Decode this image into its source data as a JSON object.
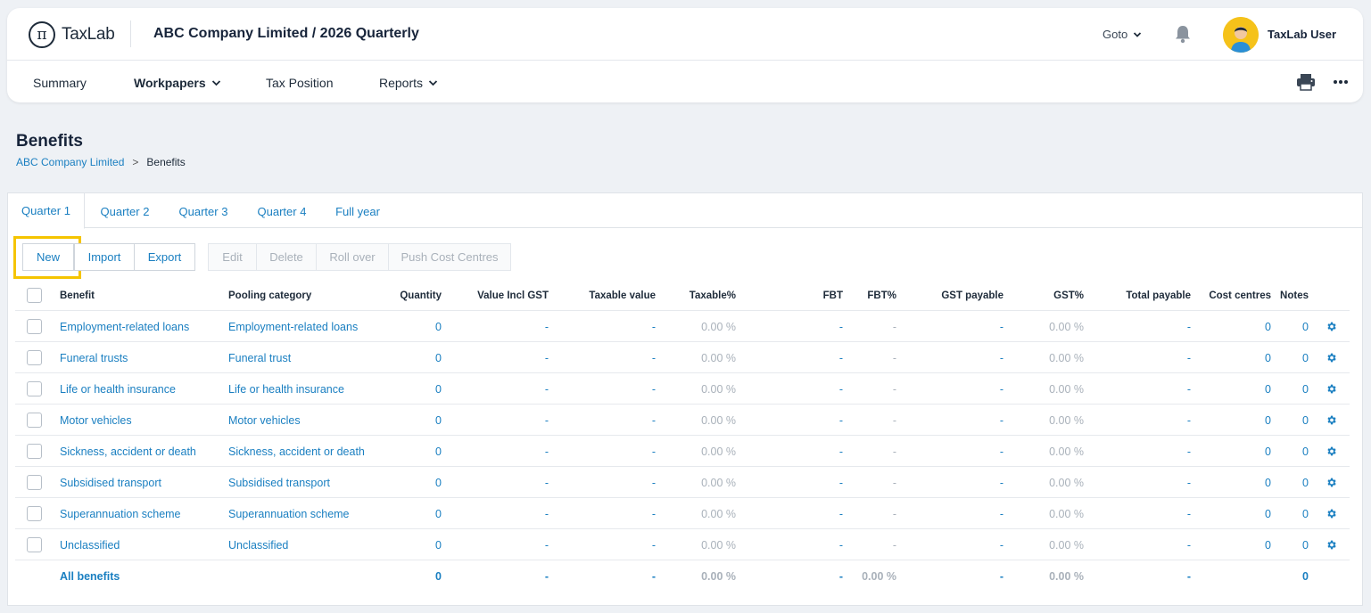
{
  "app": {
    "logo_text": "TaxLab",
    "company_title": "ABC Company Limited / 2026 Quarterly",
    "goto_label": "Goto",
    "user_name": "TaxLab User"
  },
  "nav": {
    "summary": "Summary",
    "workpapers": "Workpapers",
    "tax_position": "Tax Position",
    "reports": "Reports"
  },
  "page": {
    "title": "Benefits",
    "breadcrumb_parent": "ABC Company Limited",
    "breadcrumb_separator": ">",
    "breadcrumb_current": "Benefits"
  },
  "tabs": [
    "Quarter 1",
    "Quarter 2",
    "Quarter 3",
    "Quarter 4",
    "Full year"
  ],
  "toolbar": {
    "new": "New",
    "import": "Import",
    "export": "Export",
    "edit": "Edit",
    "delete": "Delete",
    "roll_over": "Roll over",
    "push_cost_centres": "Push Cost Centres"
  },
  "table": {
    "headers": {
      "benefit": "Benefit",
      "pooling": "Pooling category",
      "quantity": "Quantity",
      "value_incl_gst": "Value Incl GST",
      "taxable_value": "Taxable value",
      "taxable_pct": "Taxable%",
      "fbt": "FBT",
      "fbt_pct": "FBT%",
      "gst_payable": "GST payable",
      "gst_pct": "GST%",
      "total_payable": "Total payable",
      "cost_centres": "Cost centres",
      "notes": "Notes"
    },
    "rows": [
      {
        "benefit": "Employment-related loans",
        "pooling": "Employment-related loans",
        "quantity": "0",
        "value": "-",
        "taxable": "-",
        "taxable_pct": "0.00 %",
        "fbt": "-",
        "fbt_pct": "-",
        "gst": "-",
        "gst_pct": "0.00 %",
        "total": "-",
        "cost_centres": "0",
        "notes": "0"
      },
      {
        "benefit": "Funeral trusts",
        "pooling": "Funeral trust",
        "quantity": "0",
        "value": "-",
        "taxable": "-",
        "taxable_pct": "0.00 %",
        "fbt": "-",
        "fbt_pct": "-",
        "gst": "-",
        "gst_pct": "0.00 %",
        "total": "-",
        "cost_centres": "0",
        "notes": "0"
      },
      {
        "benefit": "Life or health insurance",
        "pooling": "Life or health insurance",
        "quantity": "0",
        "value": "-",
        "taxable": "-",
        "taxable_pct": "0.00 %",
        "fbt": "-",
        "fbt_pct": "-",
        "gst": "-",
        "gst_pct": "0.00 %",
        "total": "-",
        "cost_centres": "0",
        "notes": "0"
      },
      {
        "benefit": "Motor vehicles",
        "pooling": "Motor vehicles",
        "quantity": "0",
        "value": "-",
        "taxable": "-",
        "taxable_pct": "0.00 %",
        "fbt": "-",
        "fbt_pct": "-",
        "gst": "-",
        "gst_pct": "0.00 %",
        "total": "-",
        "cost_centres": "0",
        "notes": "0"
      },
      {
        "benefit": "Sickness, accident or death",
        "pooling": "Sickness, accident or death",
        "quantity": "0",
        "value": "-",
        "taxable": "-",
        "taxable_pct": "0.00 %",
        "fbt": "-",
        "fbt_pct": "-",
        "gst": "-",
        "gst_pct": "0.00 %",
        "total": "-",
        "cost_centres": "0",
        "notes": "0"
      },
      {
        "benefit": "Subsidised transport",
        "pooling": "Subsidised transport",
        "quantity": "0",
        "value": "-",
        "taxable": "-",
        "taxable_pct": "0.00 %",
        "fbt": "-",
        "fbt_pct": "-",
        "gst": "-",
        "gst_pct": "0.00 %",
        "total": "-",
        "cost_centres": "0",
        "notes": "0"
      },
      {
        "benefit": "Superannuation scheme",
        "pooling": "Superannuation scheme",
        "quantity": "0",
        "value": "-",
        "taxable": "-",
        "taxable_pct": "0.00 %",
        "fbt": "-",
        "fbt_pct": "-",
        "gst": "-",
        "gst_pct": "0.00 %",
        "total": "-",
        "cost_centres": "0",
        "notes": "0"
      },
      {
        "benefit": "Unclassified",
        "pooling": "Unclassified",
        "quantity": "0",
        "value": "-",
        "taxable": "-",
        "taxable_pct": "0.00 %",
        "fbt": "-",
        "fbt_pct": "-",
        "gst": "-",
        "gst_pct": "0.00 %",
        "total": "-",
        "cost_centres": "0",
        "notes": "0"
      }
    ],
    "total": {
      "label": "All benefits",
      "quantity": "0",
      "value": "-",
      "taxable": "-",
      "taxable_pct": "0.00 %",
      "fbt": "-",
      "fbt_pct": "0.00 %",
      "gst": "-",
      "gst_pct": "0.00 %",
      "total": "-",
      "notes": "0"
    }
  },
  "colors": {
    "link": "#1a7fc1",
    "highlight": "#f5c400",
    "muted": "#a9b1ba",
    "avatar_bg": "#f5c21a"
  },
  "icons": {
    "logo": "pi-logo-icon",
    "goto_chevron": "chevron-down-icon",
    "notifications": "bell-icon",
    "print": "printer-icon",
    "more": "more-horizontal-icon",
    "row_settings": "gear-icon"
  }
}
